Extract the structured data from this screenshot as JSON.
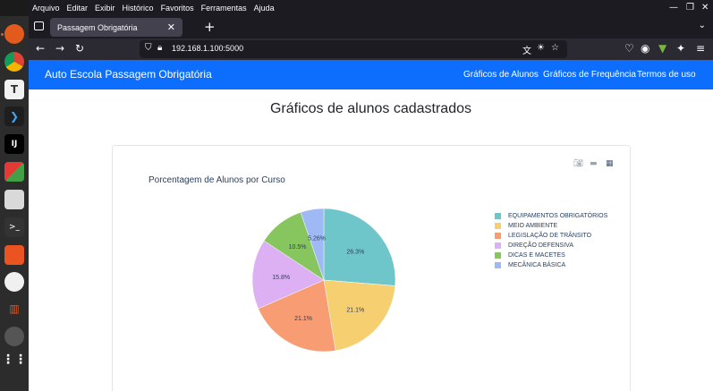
{
  "menu": [
    "Arquivo",
    "Editar",
    "Exibir",
    "Histórico",
    "Favoritos",
    "Ferramentas",
    "Ajuda"
  ],
  "tab": {
    "title": "Passagem Obrigatória"
  },
  "url": {
    "text": "192.168.1.100:5000"
  },
  "navbar": {
    "brand": "Auto Escola Passagem Obrigatória",
    "links": [
      "Gráficos de Alunos",
      "Gráficos de Frequência",
      "Termos de uso"
    ]
  },
  "page": {
    "heading": "Gráficos de alunos cadastrados"
  },
  "chart_data": {
    "type": "pie",
    "title": "Porcentagem de Alunos por Curso",
    "labels": [
      "EQUIPAMENTOS OBRIGATÓRIOS",
      "MEIO AMBIENTE",
      "LEGISLAÇÃO DE TRÂNSITO",
      "DIREÇÃO DEFENSIVA",
      "DICAS E MACETES",
      "MECÂNICA BÁSICA"
    ],
    "values": [
      26.3,
      21.1,
      21.1,
      15.8,
      10.5,
      5.26
    ],
    "value_labels": [
      "26.3%",
      "21.1%",
      "21.1%",
      "15.8%",
      "10.5%",
      "5.26%"
    ],
    "colors": [
      "#6ec6ca",
      "#f6cf71",
      "#f89c74",
      "#dcb0f2",
      "#87c55f",
      "#9eb9f3"
    ],
    "legend_position": "right"
  }
}
